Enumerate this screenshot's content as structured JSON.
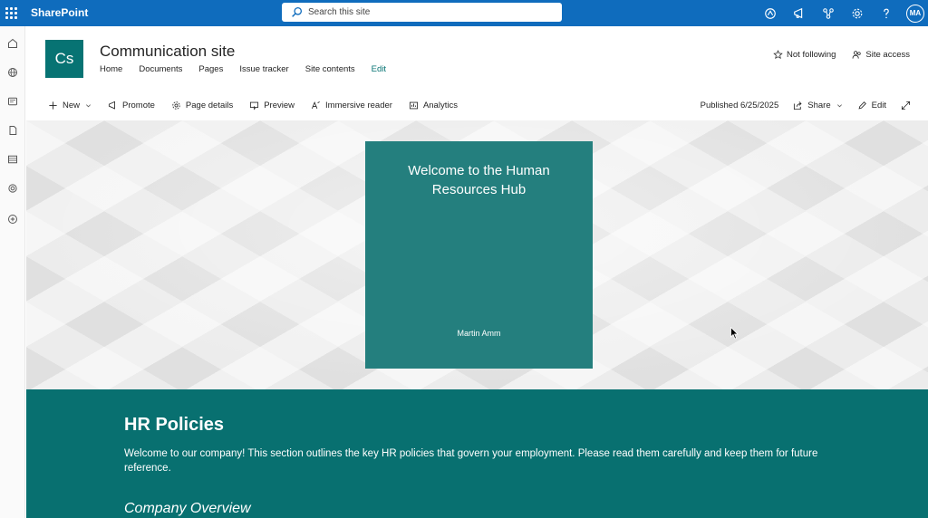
{
  "suite": {
    "brand": "SharePoint",
    "search_placeholder": "Search this site",
    "user_initials": "MA",
    "icons": [
      "copilot-icon",
      "megaphone-icon",
      "network-icon",
      "gear-icon",
      "help-icon"
    ]
  },
  "rail": {
    "icons": [
      "home-icon",
      "globe-icon",
      "news-icon",
      "file-icon",
      "list-icon",
      "loop-icon",
      "add-circle-icon"
    ]
  },
  "site": {
    "logo_text": "Cs",
    "title": "Communication site",
    "nav": [
      "Home",
      "Documents",
      "Pages",
      "Issue tracker",
      "Site contents"
    ],
    "edit_link": "Edit",
    "not_following": "Not following",
    "site_access": "Site access"
  },
  "commands": {
    "new": "New",
    "promote": "Promote",
    "page_details": "Page details",
    "preview": "Preview",
    "immersive_reader": "Immersive reader",
    "analytics": "Analytics",
    "published": "Published 6/25/2025",
    "share": "Share",
    "edit": "Edit"
  },
  "hero": {
    "title": "Welcome to the Human Resources Hub",
    "author": "Martin Amm"
  },
  "section": {
    "heading": "HR Policies",
    "body": "Welcome to our company! This section outlines the key HR policies that govern your employment. Please read them carefully and keep them for future reference.",
    "subheading": "Company Overview"
  },
  "colors": {
    "suite_blue": "#0f6cbd",
    "site_teal": "#077373",
    "hero_tile": "#247f7e"
  }
}
